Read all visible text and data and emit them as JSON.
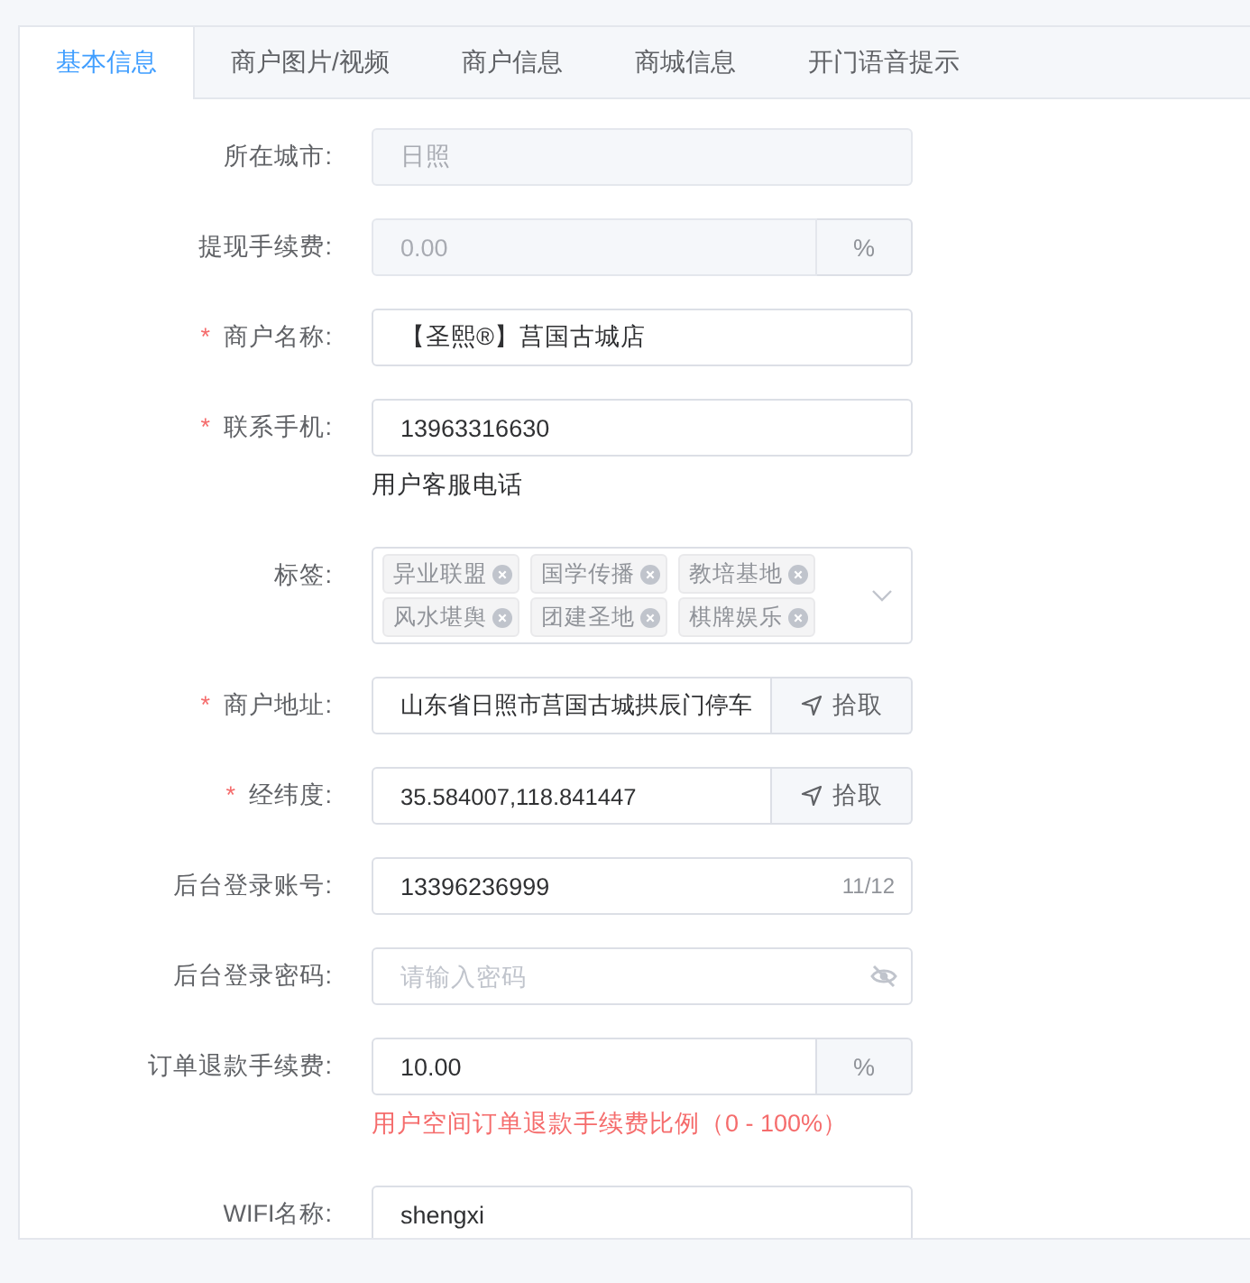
{
  "tabs": [
    {
      "label": "基本信息",
      "selected": true
    },
    {
      "label": "商户图片/视频",
      "selected": false
    },
    {
      "label": "商户信息",
      "selected": false
    },
    {
      "label": "商城信息",
      "selected": false
    },
    {
      "label": "开门语音提示",
      "selected": false
    }
  ],
  "fields": [
    {
      "kind": "input",
      "label": "所在城市:",
      "disabled": true,
      "value": "日照"
    },
    {
      "kind": "append",
      "label": "提现手续费:",
      "disabled": true,
      "value": "0.00",
      "append": "%"
    },
    {
      "kind": "input",
      "mark": "*",
      "label": "商户名称:",
      "disabled": false,
      "value": "【圣熙®】莒国古城店"
    },
    {
      "kind": "input",
      "mark": "*",
      "label": "联系手机:",
      "disabled": false,
      "value": "13963316630",
      "hint": "用户客服电话",
      "hint_error": false
    },
    {
      "kind": "tags",
      "label": "标签:",
      "tags": [
        "异业联盟",
        "国学传播",
        "教培基地",
        "风水堪舆",
        "团建圣地",
        "棋牌娱乐"
      ]
    },
    {
      "kind": "button",
      "mark": "*",
      "label": "商户地址:",
      "disabled": false,
      "value": "山东省日照市莒国古城拱辰门停车",
      "button": "拾取"
    },
    {
      "kind": "button",
      "mark": "*",
      "label": "经纬度:",
      "disabled": false,
      "value": "35.584007,118.841447",
      "button": "拾取"
    },
    {
      "kind": "counter",
      "label": "后台登录账号:",
      "value": "13396236999",
      "counter": "11/12"
    },
    {
      "kind": "password",
      "label": "后台登录密码:",
      "placeholder": "请输入密码"
    },
    {
      "kind": "append",
      "label": "订单退款手续费:",
      "disabled": false,
      "value": "10.00",
      "append": "%",
      "hint": "用户空间订单退款手续费比例（0 - 100%）",
      "hint_error": true
    },
    {
      "kind": "input",
      "label": "WIFI名称:",
      "disabled": false,
      "value": "shengxi"
    }
  ]
}
